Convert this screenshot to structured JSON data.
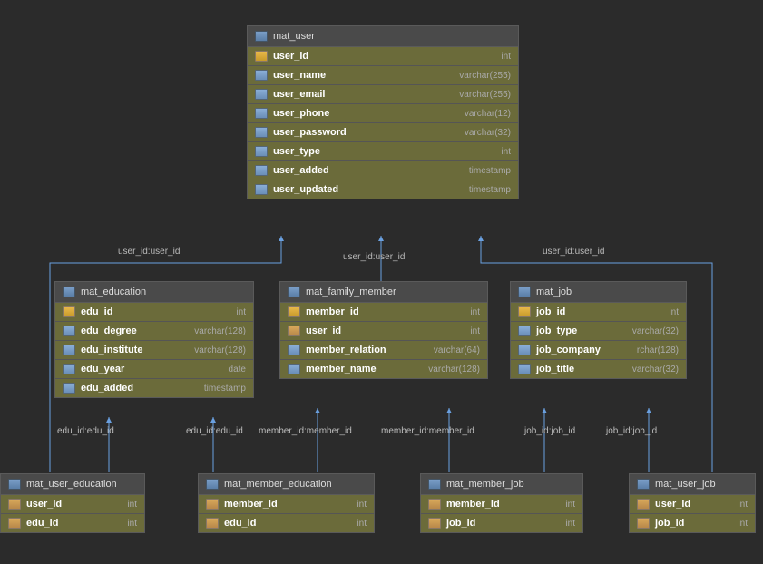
{
  "tables": {
    "mat_user": {
      "title": "mat_user",
      "cols": [
        {
          "icon": "pk",
          "name": "user_id",
          "type": "int"
        },
        {
          "icon": "col",
          "name": "user_name",
          "type": "varchar(255)"
        },
        {
          "icon": "col",
          "name": "user_email",
          "type": "varchar(255)"
        },
        {
          "icon": "col",
          "name": "user_phone",
          "type": "varchar(12)"
        },
        {
          "icon": "col",
          "name": "user_password",
          "type": "varchar(32)"
        },
        {
          "icon": "col",
          "name": "user_type",
          "type": "int"
        },
        {
          "icon": "col",
          "name": "user_added",
          "type": "timestamp"
        },
        {
          "icon": "col",
          "name": "user_updated",
          "type": "timestamp"
        }
      ]
    },
    "mat_education": {
      "title": "mat_education",
      "cols": [
        {
          "icon": "pk",
          "name": "edu_id",
          "type": "int"
        },
        {
          "icon": "col",
          "name": "edu_degree",
          "type": "varchar(128)"
        },
        {
          "icon": "col",
          "name": "edu_institute",
          "type": "varchar(128)"
        },
        {
          "icon": "col",
          "name": "edu_year",
          "type": "date"
        },
        {
          "icon": "col",
          "name": "edu_added",
          "type": "timestamp"
        }
      ]
    },
    "mat_family_member": {
      "title": "mat_family_member",
      "cols": [
        {
          "icon": "pk",
          "name": "member_id",
          "type": "int"
        },
        {
          "icon": "fk",
          "name": "user_id",
          "type": "int"
        },
        {
          "icon": "col",
          "name": "member_relation",
          "type": "varchar(64)"
        },
        {
          "icon": "col",
          "name": "member_name",
          "type": "varchar(128)"
        }
      ]
    },
    "mat_job": {
      "title": "mat_job",
      "cols": [
        {
          "icon": "pk",
          "name": "job_id",
          "type": "int"
        },
        {
          "icon": "col",
          "name": "job_type",
          "type": "varchar(32)"
        },
        {
          "icon": "col",
          "name": "job_company",
          "type": "rchar(128)"
        },
        {
          "icon": "col",
          "name": "job_title",
          "type": "varchar(32)"
        }
      ]
    },
    "mat_user_education": {
      "title": "mat_user_education",
      "cols": [
        {
          "icon": "fk",
          "name": "user_id",
          "type": "int"
        },
        {
          "icon": "fk",
          "name": "edu_id",
          "type": "int"
        }
      ]
    },
    "mat_member_education": {
      "title": "mat_member_education",
      "cols": [
        {
          "icon": "fk",
          "name": "member_id",
          "type": "int"
        },
        {
          "icon": "fk",
          "name": "edu_id",
          "type": "int"
        }
      ]
    },
    "mat_member_job": {
      "title": "mat_member_job",
      "cols": [
        {
          "icon": "fk",
          "name": "member_id",
          "type": "int"
        },
        {
          "icon": "fk",
          "name": "job_id",
          "type": "int"
        }
      ]
    },
    "mat_user_job": {
      "title": "mat_user_job",
      "cols": [
        {
          "icon": "fk",
          "name": "user_id",
          "type": "int"
        },
        {
          "icon": "fk",
          "name": "job_id",
          "type": "int"
        }
      ]
    }
  },
  "labels": {
    "l1": "user_id:user_id",
    "l2": "user_id:user_id",
    "l3": "user_id:user_id",
    "l4": "edu_id:edu_id",
    "l5": "edu_id:edu_id",
    "l6": "member_id:member_id",
    "l7": "member_id:member_id",
    "l8": "job_id:job_id",
    "l9": "job_id:job_id"
  }
}
